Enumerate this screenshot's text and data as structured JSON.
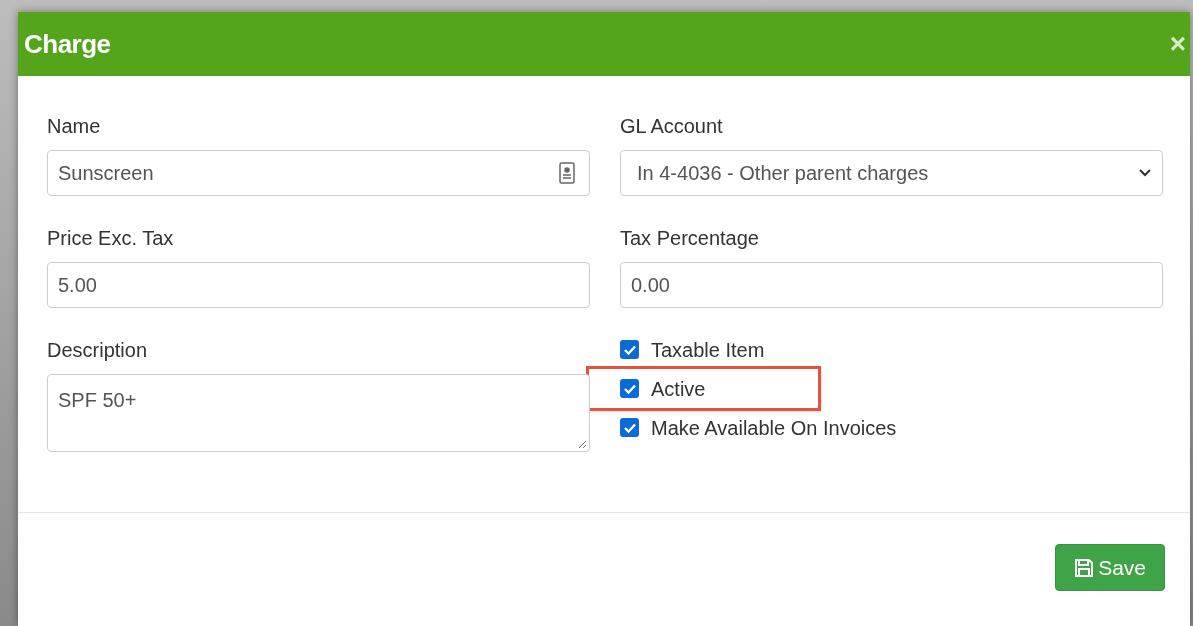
{
  "dialog": {
    "title": "Charge",
    "close": "×"
  },
  "fields": [
    {
      "kind": "text",
      "label": "Name",
      "value": "Sunscreen",
      "has_contact_icon": true
    },
    {
      "kind": "select",
      "label": "GL Account",
      "value": "In 4-4036 - Other parent charges"
    },
    {
      "kind": "text",
      "label": "Price Exc. Tax",
      "value": "5.00",
      "has_contact_icon": false
    },
    {
      "kind": "text",
      "label": "Tax Percentage",
      "value": "0.00",
      "has_contact_icon": false
    },
    {
      "kind": "textarea",
      "label": "Description",
      "value": "SPF 50+"
    },
    {
      "kind": "checkboxes",
      "items": [
        {
          "label": "Taxable Item",
          "checked": true,
          "highlighted": false
        },
        {
          "label": "Active",
          "checked": true,
          "highlighted": true
        },
        {
          "label": "Make Available On Invoices",
          "checked": true,
          "highlighted": false
        }
      ]
    }
  ],
  "footer": {
    "save_button": "Save"
  }
}
